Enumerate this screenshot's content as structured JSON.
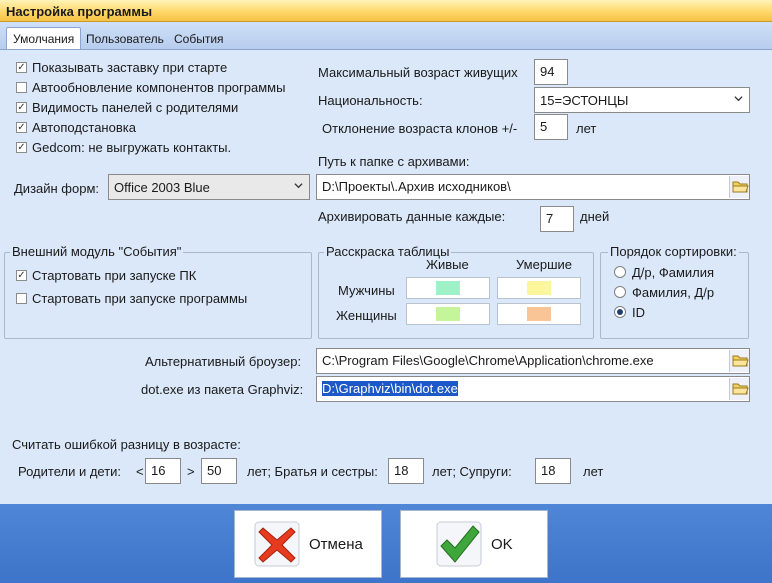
{
  "window": {
    "title": "Настройка программы"
  },
  "tabs": [
    {
      "label": "Умолчания",
      "active": true
    },
    {
      "label": "Пользователь",
      "active": false
    },
    {
      "label": "События",
      "active": false
    }
  ],
  "options": [
    {
      "label": "Показывать заставку при старте",
      "checked": true
    },
    {
      "label": "Автообновление компонентов программы",
      "checked": false
    },
    {
      "label": "Видимость панелей с родителями",
      "checked": true
    },
    {
      "label": "Автоподстановка",
      "checked": true
    },
    {
      "label": "Gedcom: не выгружать контакты.",
      "checked": true
    }
  ],
  "right_fields": {
    "max_age_label": "Максимальный возраст живущих",
    "max_age_value": "94",
    "nationality_label": "Национальность:",
    "nationality_value": "15=ЭСТОНЦЫ",
    "clone_dev_label": "Отклонение возраста клонов +/-",
    "clone_dev_value": "5",
    "clone_dev_unit": "лет",
    "archive_path_label": "Путь к папке с архивами:",
    "archive_path_value": "D:\\Проекты\\.Архив исходников\\",
    "archive_every_label": "Архивировать данные каждые:",
    "archive_every_value": "7",
    "archive_every_unit": "дней"
  },
  "design": {
    "label": "Дизайн форм:",
    "value": "Office 2003 Blue"
  },
  "events_module": {
    "title": "Внешний модуль \"События\"",
    "items": [
      {
        "label": "Стартовать при запуске ПК",
        "checked": true
      },
      {
        "label": "Стартовать при запуске программы",
        "checked": false
      }
    ]
  },
  "table_colors": {
    "title": "Расскраска таблицы",
    "col_alive": "Живые",
    "col_dead": "Умершие",
    "row_men": "Мужчины",
    "row_women": "Женщины",
    "men_alive_color": "#9ff2c8",
    "men_dead_color": "#fbf69c",
    "women_alive_color": "#c4f59a",
    "women_dead_color": "#f9c596"
  },
  "sort_order": {
    "title": "Порядок сортировки:",
    "options": [
      {
        "label": "Д/р, Фамилия",
        "selected": false
      },
      {
        "label": "Фамилия, Д/р",
        "selected": false
      },
      {
        "label": "ID",
        "selected": true
      }
    ]
  },
  "paths": {
    "browser_label": "Альтернативный броузер:",
    "browser_value": "C:\\Program Files\\Google\\Chrome\\Application\\chrome.exe",
    "dot_label": "dot.exe из пакета Graphviz:",
    "dot_value": "D:\\Graphviz\\bin\\dot.exe"
  },
  "age_diff": {
    "title": "Считать ошибкой разницу в возрасте:",
    "parents_label": "Родители и дети:",
    "lt": "<",
    "parents_min": "16",
    "gt": ">",
    "parents_max": "50",
    "siblings_label": "лет; Братья и сестры:",
    "siblings_value": "18",
    "spouses_label": "лет; Супруги:",
    "spouses_value": "18",
    "unit": "лет"
  },
  "buttons": {
    "cancel": "Отмена",
    "ok": "OK"
  },
  "colors": {
    "accent": "#ffd86a",
    "panel": "#dbe8f9",
    "bottom": "#4f86d6",
    "cancel_red": "#e63b1f",
    "ok_green": "#3fa63c"
  }
}
